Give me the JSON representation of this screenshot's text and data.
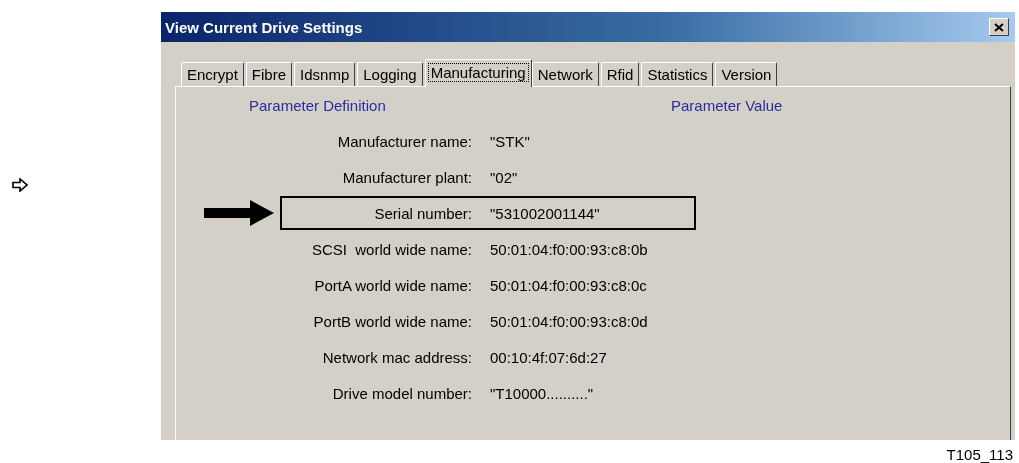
{
  "window": {
    "title": "View Current Drive Settings"
  },
  "tabs": [
    {
      "label": "Encrypt",
      "selected": false
    },
    {
      "label": "Fibre",
      "selected": false
    },
    {
      "label": "Idsnmp",
      "selected": false
    },
    {
      "label": "Logging",
      "selected": false
    },
    {
      "label": "Manufacturing",
      "selected": true
    },
    {
      "label": "Network",
      "selected": false
    },
    {
      "label": "Rfid",
      "selected": false
    },
    {
      "label": "Statistics",
      "selected": false
    },
    {
      "label": "Version",
      "selected": false
    }
  ],
  "columns": [
    "Parameter Definition",
    "Parameter Value"
  ],
  "parameters": [
    {
      "name": "Manufacturer name:",
      "value": "\"STK\"",
      "highlighted": false
    },
    {
      "name": "Manufacturer plant:",
      "value": "\"02\"",
      "highlighted": false
    },
    {
      "name": "Serial number:",
      "value": "\"531002001144\"",
      "highlighted": true
    },
    {
      "name": "SCSI  world wide name:",
      "value": "50:01:04:f0:00:93:c8:0b",
      "highlighted": false
    },
    {
      "name": "PortA world wide name:",
      "value": "50:01:04:f0:00:93:c8:0c",
      "highlighted": false
    },
    {
      "name": "PortB world wide name:",
      "value": "50:01:04:f0:00:93:c8:0d",
      "highlighted": false
    },
    {
      "name": "Network mac address:",
      "value": "00:10:4f:07:6d:27",
      "highlighted": false
    },
    {
      "name": "Drive model number:",
      "value": "\"T10000..........\"",
      "highlighted": false
    }
  ],
  "figure_id": "T105_113"
}
